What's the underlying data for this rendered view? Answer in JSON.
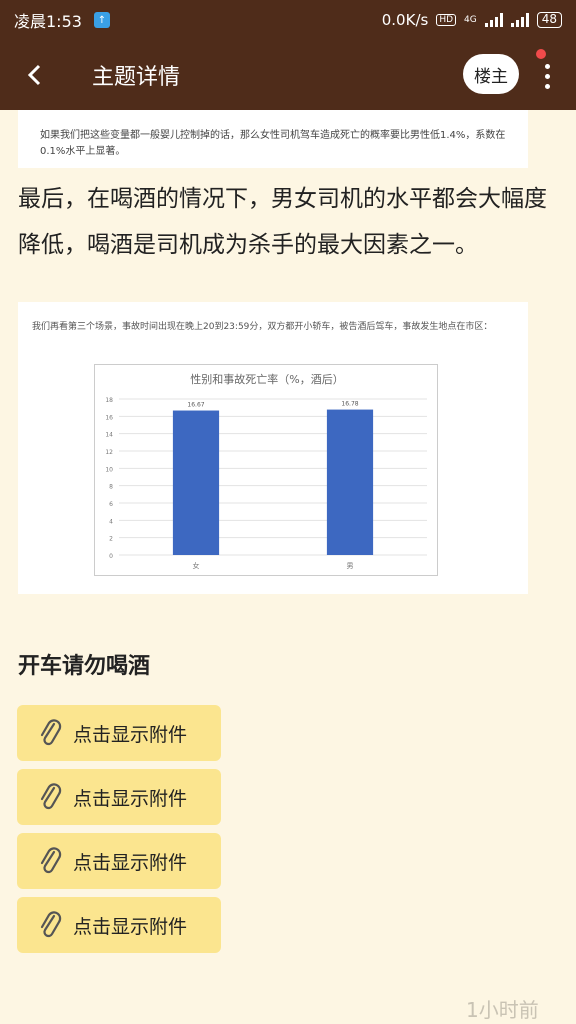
{
  "status_bar": {
    "time": "凌晨1:53",
    "network_speed": "0.0K/s",
    "network_type": "4G",
    "battery": "48"
  },
  "top_bar": {
    "title": "主题详情",
    "op_label": "楼主"
  },
  "post": {
    "image_top_text": "如果我们把这些变量都一般婴儿控制掉的话，那么女性司机驾车造成死亡的概率要比男性低1.4%，系数在0.1%水平上显著。",
    "paragraph": "最后，在喝酒的情况下，男女司机的水平都会大幅度降低，喝酒是司机成为杀手的最大因素之一。",
    "chart_caption": "我们再看第三个场景，事故时间出现在晚上20到23:59分，双方都开小轿车，被告酒后驾车，事故发生地点在市区：",
    "heading": "开车请勿喝酒",
    "attachments": [
      "点击显示附件",
      "点击显示附件",
      "点击显示附件",
      "点击显示附件"
    ],
    "time_ago": "1小时前"
  },
  "colors": {
    "header": "#4f2c1a",
    "background": "#fdf6e3",
    "attachment": "#fbe58f",
    "bar": "#3d68c1"
  },
  "chart_data": {
    "type": "bar",
    "title": "性别和事故死亡率（%，酒后）",
    "categories": [
      "女",
      "男"
    ],
    "values": [
      16.67,
      16.78
    ],
    "ylim": [
      0,
      18
    ],
    "yticks": [
      0,
      2,
      4,
      6,
      8,
      10,
      12,
      14,
      16,
      18
    ],
    "grid": true
  }
}
